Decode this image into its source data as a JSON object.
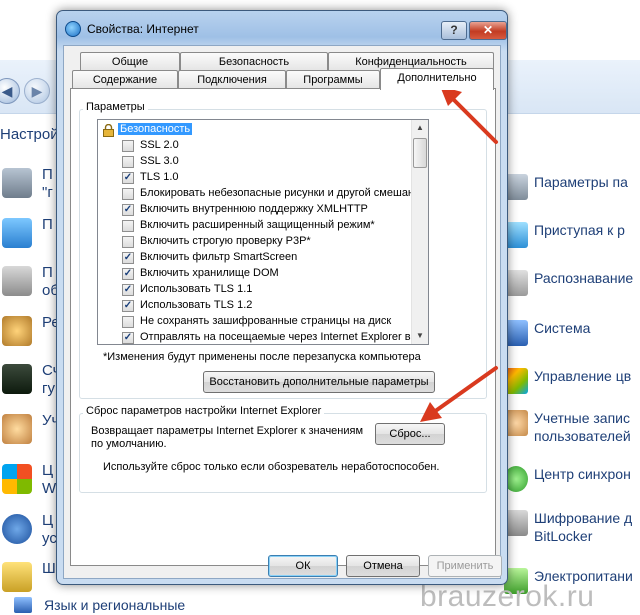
{
  "background": {
    "settings_title": "Настрой",
    "left_items": [
      {
        "label": "П",
        "sub": "\"г"
      },
      {
        "label": "П",
        "sub": ""
      },
      {
        "label": "П",
        "sub": "об"
      },
      {
        "label": "Ре",
        "sub": ""
      },
      {
        "label": "Сч",
        "sub": "гу"
      },
      {
        "label": "Уч",
        "sub": ""
      },
      {
        "label": "Ц",
        "sub": "W"
      },
      {
        "label": "Ц",
        "sub": "ус"
      },
      {
        "label": "Ш",
        "sub": ""
      }
    ],
    "right_items": [
      {
        "label": "Параметры па",
        "label2": ""
      },
      {
        "label": "Приступая к р",
        "label2": ""
      },
      {
        "label": "Распознавание",
        "label2": ""
      },
      {
        "label": "Система",
        "label2": ""
      },
      {
        "label": "Управление цв",
        "label2": ""
      },
      {
        "label": "Учетные запис",
        "label2": "пользователей"
      },
      {
        "label": "Центр синхрон",
        "label2": ""
      },
      {
        "label": "Шифрование д",
        "label2": "BitLocker"
      },
      {
        "label": "Электропитани",
        "label2": ""
      }
    ],
    "bottom_item": "Язык и региональные",
    "watermark": "brauzerok.ru"
  },
  "dialog": {
    "title": "Свойства: Интернет",
    "help_label": "?",
    "close_label": "✕",
    "tabs_row1": [
      "Общие",
      "Безопасность",
      "Конфиденциальность"
    ],
    "tabs_row2": [
      "Содержание",
      "Подключения",
      "Программы",
      "Дополнительно"
    ],
    "active_tab": "Дополнительно",
    "params_group_title": "Параметры",
    "settings_list": {
      "header": "Безопасность",
      "items": [
        {
          "label": "SSL 2.0",
          "checked": false
        },
        {
          "label": "SSL 3.0",
          "checked": false
        },
        {
          "label": "TLS 1.0",
          "checked": true
        },
        {
          "label": "Блокировать небезопасные рисунки и другой смешан",
          "checked": false
        },
        {
          "label": "Включить внутреннюю поддержку XMLHTTP",
          "checked": true
        },
        {
          "label": "Включить расширенный защищенный режим*",
          "checked": false
        },
        {
          "label": "Включить строгую проверку P3P*",
          "checked": false
        },
        {
          "label": "Включить фильтр SmartScreen",
          "checked": true
        },
        {
          "label": "Включить хранилище DOM",
          "checked": true
        },
        {
          "label": "Использовать TLS 1.1",
          "checked": true
        },
        {
          "label": "Использовать TLS 1.2",
          "checked": true
        },
        {
          "label": "Не сохранять зашифрованные страницы на диск",
          "checked": false
        },
        {
          "label": "Отправлять на посещаемые через Internet Explorer ве",
          "checked": true
        }
      ]
    },
    "restart_note": "*Изменения будут применены после перезапуска компьютера",
    "restore_button": "Восстановить дополнительные параметры",
    "reset_group_title": "Сброс параметров настройки Internet Explorer",
    "reset_description_line1": "Возвращает параметры Internet Explorer к значениям",
    "reset_description_line2": "по умолчанию.",
    "reset_button": "Сброс...",
    "reset_warning": "Используйте сброс только если обозреватель неработоспособен.",
    "ok_button": "ОК",
    "cancel_button": "Отмена",
    "apply_button": "Применить"
  },
  "colors": {
    "arrow": "#d93a1f",
    "selection": "#3399ff"
  }
}
